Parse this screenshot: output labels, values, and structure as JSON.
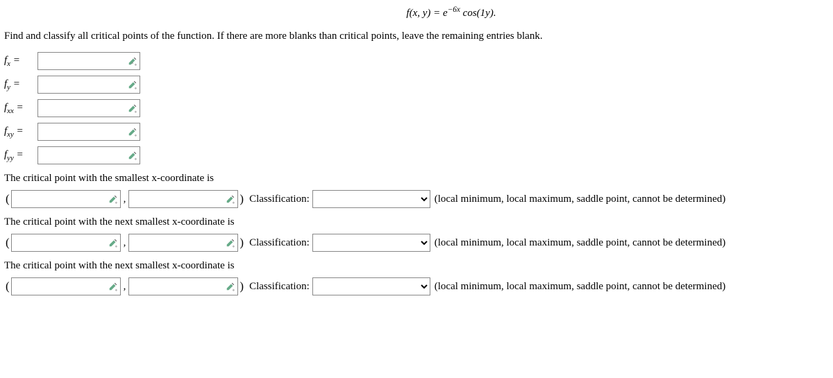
{
  "equation": "f(x, y) = e^{−6x} cos(1y).",
  "instruction": "Find and classify all critical points of the function. If there are more blanks than critical points, leave the remaining entries blank.",
  "derivatives": [
    {
      "label_main": "f",
      "label_sub": "x"
    },
    {
      "label_main": "f",
      "label_sub": "y"
    },
    {
      "label_main": "f",
      "label_sub": "xx"
    },
    {
      "label_main": "f",
      "label_sub": "xy"
    },
    {
      "label_main": "f",
      "label_sub": "yy"
    }
  ],
  "equals_sign": "=",
  "critical_points": [
    {
      "intro": "The critical point with the smallest x-coordinate is"
    },
    {
      "intro": "The critical point with the next smallest x-coordinate is"
    },
    {
      "intro": "The critical point with the next smallest x-coordinate is"
    }
  ],
  "open_paren": "(",
  "close_paren": ")",
  "comma": ",",
  "classification_label": "Classification:",
  "classification_hint": "(local minimum, local maximum, saddle point, cannot be determined)",
  "select_empty": ""
}
